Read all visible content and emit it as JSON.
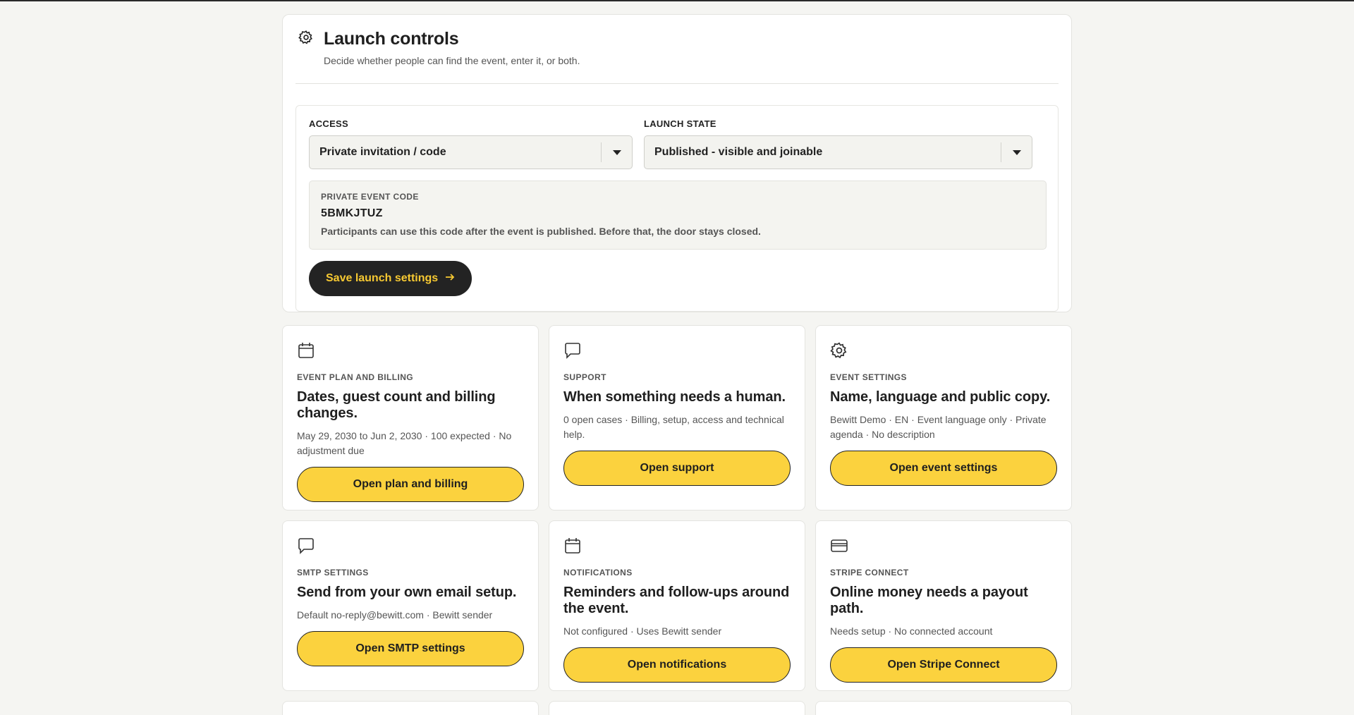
{
  "launch": {
    "title": "Launch controls",
    "subtitle": "Decide whether people can find the event, enter it, or both.",
    "access_label": "ACCESS",
    "access_value": "Private invitation / code",
    "state_label": "LAUNCH STATE",
    "state_value": "Published - visible and joinable",
    "code_label": "PRIVATE EVENT CODE",
    "code_value": "5BMKJTUZ",
    "code_help": "Participants can use this code after the event is published. Before that, the door stays closed.",
    "save_label": "Save launch settings"
  },
  "cards": [
    {
      "icon": "calendar-icon",
      "kicker": "EVENT PLAN AND BILLING",
      "title": "Dates, guest count and billing changes.",
      "meta": "May 29, 2030 to Jun 2, 2030 · 100 expected · No adjustment due",
      "button": "Open plan and billing"
    },
    {
      "icon": "chat-icon",
      "kicker": "SUPPORT",
      "title": "When something needs a human.",
      "meta": "0 open cases · Billing, setup, access and technical help.",
      "button": "Open support"
    },
    {
      "icon": "gear-icon",
      "kicker": "EVENT SETTINGS",
      "title": "Name, language and public copy.",
      "meta": "Bewitt Demo · EN · Event language only · Private agenda · No description",
      "button": "Open event settings"
    },
    {
      "icon": "chat-icon",
      "kicker": "SMTP SETTINGS",
      "title": "Send from your own email setup.",
      "meta": "Default no-reply@bewitt.com · Bewitt sender",
      "button": "Open SMTP settings"
    },
    {
      "icon": "calendar-icon",
      "kicker": "NOTIFICATIONS",
      "title": "Reminders and follow-ups around the event.",
      "meta": "Not configured · Uses Bewitt sender",
      "button": "Open notifications"
    },
    {
      "icon": "card-icon",
      "kicker": "STRIPE CONNECT",
      "title": "Online money needs a payout path.",
      "meta": "Needs setup · No connected account",
      "button": "Open Stripe Connect"
    }
  ]
}
